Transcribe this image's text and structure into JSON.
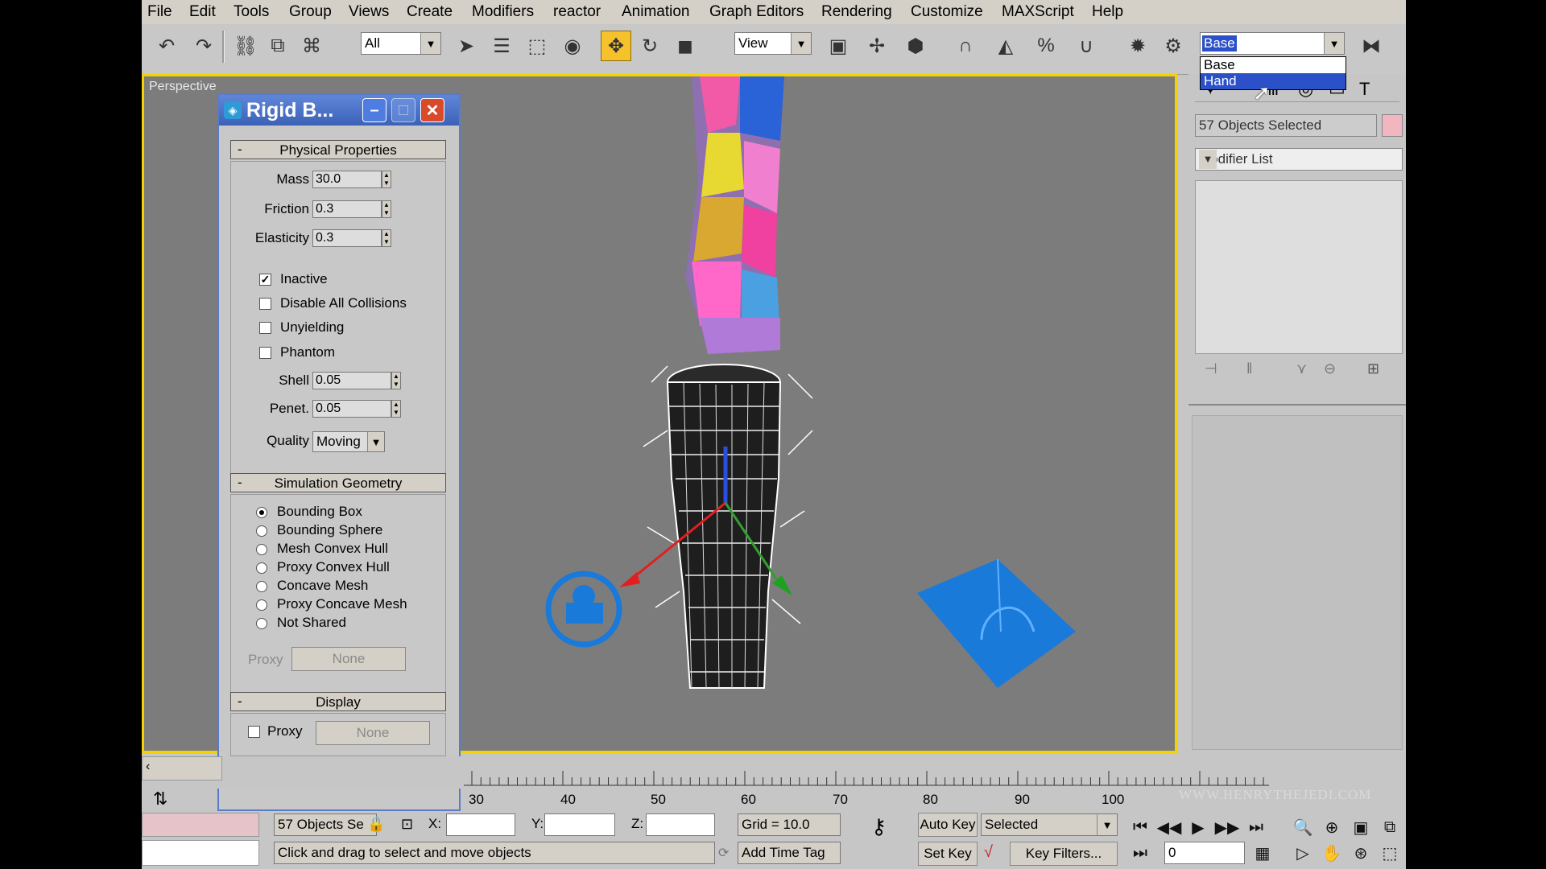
{
  "menu": [
    "File",
    "Edit",
    "Tools",
    "Group",
    "Views",
    "Create",
    "Modifiers",
    "reactor",
    "Animation",
    "Graph Editors",
    "Rendering",
    "Customize",
    "MAXScript",
    "Help"
  ],
  "toolbar": {
    "selection_filter": "All",
    "ref_coord": "View",
    "named_selection": "Base",
    "named_selection_options": [
      "Base",
      "Hand"
    ],
    "highlighted_option": "Hand"
  },
  "viewport": {
    "label": "Perspective"
  },
  "dialog": {
    "title": "Rigid B...",
    "physical": {
      "header": "Physical Properties",
      "collapse": "-",
      "mass_label": "Mass",
      "mass": "30.0",
      "friction_label": "Friction",
      "friction": "0.3",
      "elasticity_label": "Elasticity",
      "elasticity": "0.3",
      "checks": [
        {
          "label": "Inactive",
          "checked": true
        },
        {
          "label": "Disable All Collisions",
          "checked": false
        },
        {
          "label": "Unyielding",
          "checked": false
        },
        {
          "label": "Phantom",
          "checked": false
        }
      ],
      "shell_label": "Shell",
      "shell": "0.05",
      "penet_label": "Penet.",
      "penet": "0.05",
      "quality_label": "Quality",
      "quality": "Moving"
    },
    "simulation": {
      "header": "Simulation Geometry",
      "collapse": "-",
      "options": [
        "Bounding Box",
        "Bounding Sphere",
        "Mesh Convex Hull",
        "Proxy Convex Hull",
        "Concave Mesh",
        "Proxy Concave Mesh",
        "Not Shared"
      ],
      "selected": 0,
      "proxy_label": "Proxy",
      "proxy_button": "None"
    },
    "display": {
      "header": "Display",
      "collapse": "-",
      "proxy_check_label": "Proxy",
      "proxy_button": "None"
    }
  },
  "command_panel": {
    "selection_info": "57 Objects Selected",
    "modifier_list": "Modifier List"
  },
  "timeline": {
    "ticks": [
      "30",
      "40",
      "50",
      "60",
      "70",
      "80",
      "90",
      "100"
    ]
  },
  "status": {
    "selection": "57 Objects Se",
    "x_label": "X:",
    "y_label": "Y:",
    "z_label": "Z:",
    "grid": "Grid = 10.0",
    "prompt": "Click and drag to select and move objects",
    "add_time_tag": "Add Time Tag",
    "auto_key": "Auto Key",
    "set_key": "Set Key",
    "selected": "Selected",
    "key_filters": "Key Filters...",
    "frame": "0"
  },
  "watermark": "WWW.HENRYTHEJEDI.COM",
  "colors": {
    "accent_yellow": "#f2d200",
    "viewport_bg": "#7c7c7c",
    "title_blue": "#3c62b8",
    "object_blue": "#1a7ad9",
    "highlight": "#2b50c8"
  }
}
